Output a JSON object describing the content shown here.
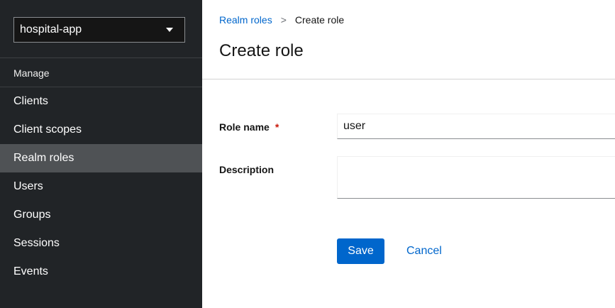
{
  "sidebar": {
    "realm_selector": {
      "value": "hospital-app",
      "icon": "caret-down-icon"
    },
    "section_title": "Manage",
    "items": [
      {
        "label": "Clients",
        "active": false
      },
      {
        "label": "Client scopes",
        "active": false
      },
      {
        "label": "Realm roles",
        "active": true
      },
      {
        "label": "Users",
        "active": false
      },
      {
        "label": "Groups",
        "active": false
      },
      {
        "label": "Sessions",
        "active": false
      },
      {
        "label": "Events",
        "active": false
      }
    ]
  },
  "breadcrumb": {
    "parent": "Realm roles",
    "separator": ">",
    "current": "Create role"
  },
  "page": {
    "title": "Create role"
  },
  "form": {
    "role_name": {
      "label": "Role name",
      "required_marker": "*",
      "value": "user"
    },
    "description": {
      "label": "Description",
      "value": ""
    },
    "save_label": "Save",
    "cancel_label": "Cancel"
  },
  "colors": {
    "sidebar_bg": "#212427",
    "active_item_bg": "#4f5255",
    "primary": "#0066cc",
    "required": "#c9190b"
  }
}
